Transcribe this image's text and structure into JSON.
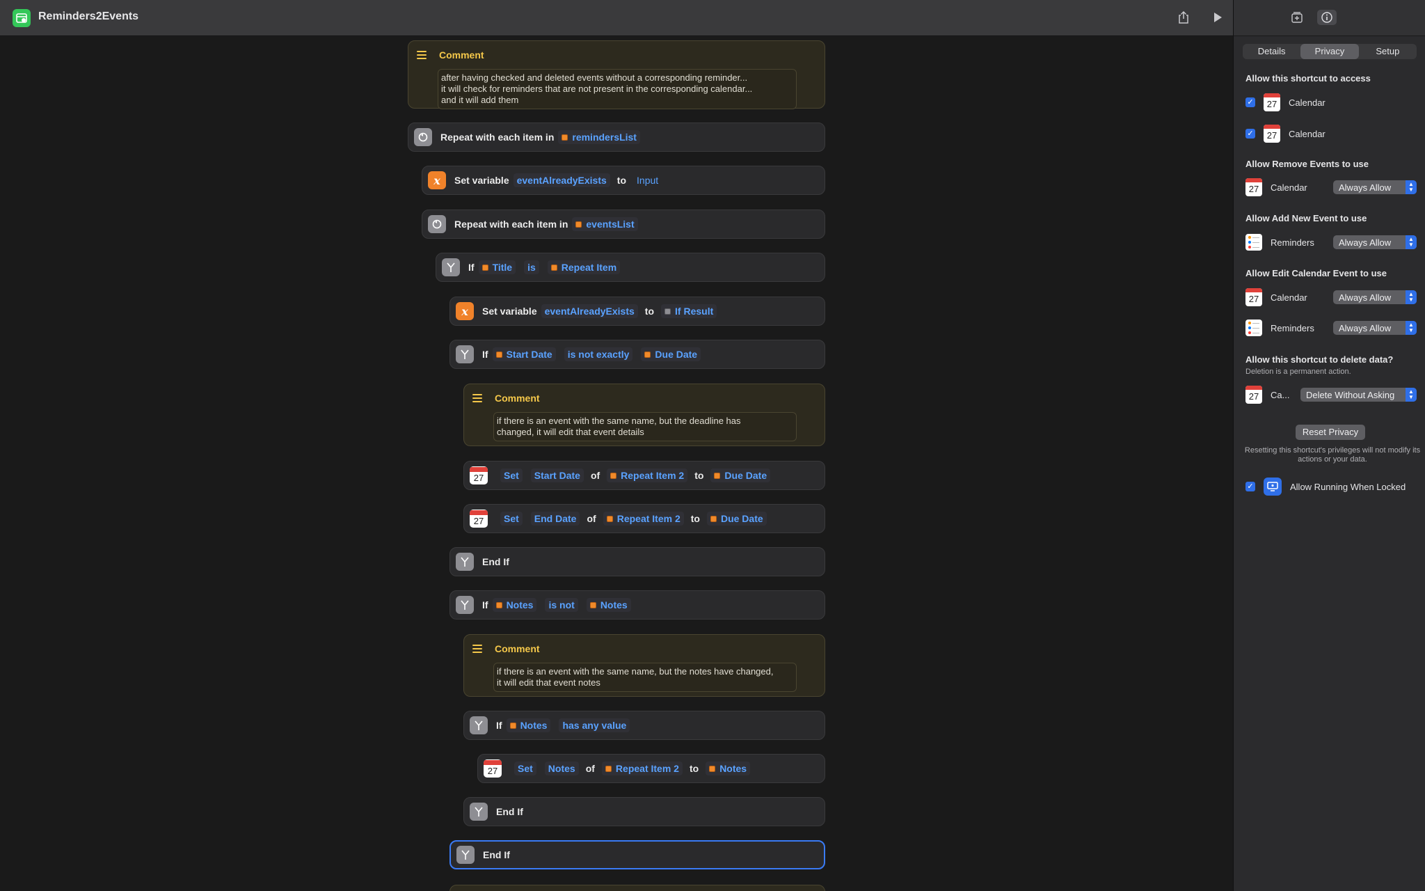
{
  "window": {
    "title": "Reminders2Events"
  },
  "editor": {
    "comment1": {
      "title": "Comment",
      "lines": [
        "after having checked and deleted events without a corresponding reminder...",
        "it will check for reminders that are not present in the corresponding calendar...",
        "and it will add them"
      ]
    },
    "repeat1": {
      "label": "Repeat with each item in",
      "var": "remindersList"
    },
    "setvar1": {
      "label": "Set variable",
      "name": "eventAlreadyExists",
      "to": "to",
      "value": "Input"
    },
    "repeat2": {
      "label": "Repeat with each item in",
      "var": "eventsList"
    },
    "if1": {
      "label": "If",
      "a": "Title",
      "op": "is",
      "b": "Repeat Item"
    },
    "setvar2": {
      "label": "Set variable",
      "name": "eventAlreadyExists",
      "to": "to",
      "value": "If Result"
    },
    "if2": {
      "label": "If",
      "a": "Start Date",
      "op": "is not exactly",
      "b": "Due Date"
    },
    "comment2": {
      "title": "Comment",
      "lines": [
        "if there is an event with the same name, but the deadline has",
        "changed, it will edit that event details"
      ]
    },
    "set1": {
      "set": "Set",
      "field": "Start Date",
      "of": "of",
      "item": "Repeat Item 2",
      "to": "to",
      "value": "Due Date"
    },
    "set2": {
      "set": "Set",
      "field": "End Date",
      "of": "of",
      "item": "Repeat Item 2",
      "to": "to",
      "value": "Due Date"
    },
    "endif1": {
      "label": "End If"
    },
    "if3": {
      "label": "If",
      "a": "Notes",
      "op": "is not",
      "b": "Notes"
    },
    "comment3": {
      "title": "Comment",
      "lines": [
        "if there is an event with the same name, but the notes have changed,",
        "it will edit that event notes"
      ]
    },
    "if4": {
      "label": "If",
      "a": "Notes",
      "op": "has any value"
    },
    "set3": {
      "set": "Set",
      "field": "Notes",
      "of": "of",
      "item": "Repeat Item 2",
      "to": "to",
      "value": "Notes"
    },
    "endif2": {
      "label": "End If"
    },
    "endif3": {
      "label": "End If"
    }
  },
  "sidebar": {
    "tabs": [
      "Details",
      "Privacy",
      "Setup"
    ],
    "active_tab": "Privacy",
    "access_title": "Allow this shortcut to access",
    "access_items": [
      {
        "app": "Calendar",
        "checked": true,
        "cal_day": "27"
      },
      {
        "app": "Calendar",
        "checked": true,
        "cal_day": "27"
      }
    ],
    "remove_title": "Allow Remove Events to use",
    "remove_row": {
      "app": "Calendar",
      "value": "Always Allow"
    },
    "add_title": "Allow Add New Event to use",
    "add_row": {
      "app": "Reminders",
      "value": "Always Allow"
    },
    "edit_title": "Allow Edit Calendar Event to use",
    "edit_rows": [
      {
        "app": "Calendar",
        "value": "Always Allow"
      },
      {
        "app": "Reminders",
        "value": "Always Allow"
      }
    ],
    "delete_title": "Allow this shortcut to delete data?",
    "delete_sub": "Deletion is a permanent action.",
    "delete_row": {
      "app": "Ca...",
      "value": "Delete Without Asking"
    },
    "reset_button": "Reset Privacy",
    "reset_note": "Resetting this shortcut's privileges will not modify its actions or your data.",
    "locked": {
      "label": "Allow Running When Locked",
      "checked": true
    }
  },
  "colors": {
    "accent": "#2f6fe8",
    "variable": "#5aa2ff",
    "comment": "#f5c84a",
    "app_icon": "#34c759"
  }
}
